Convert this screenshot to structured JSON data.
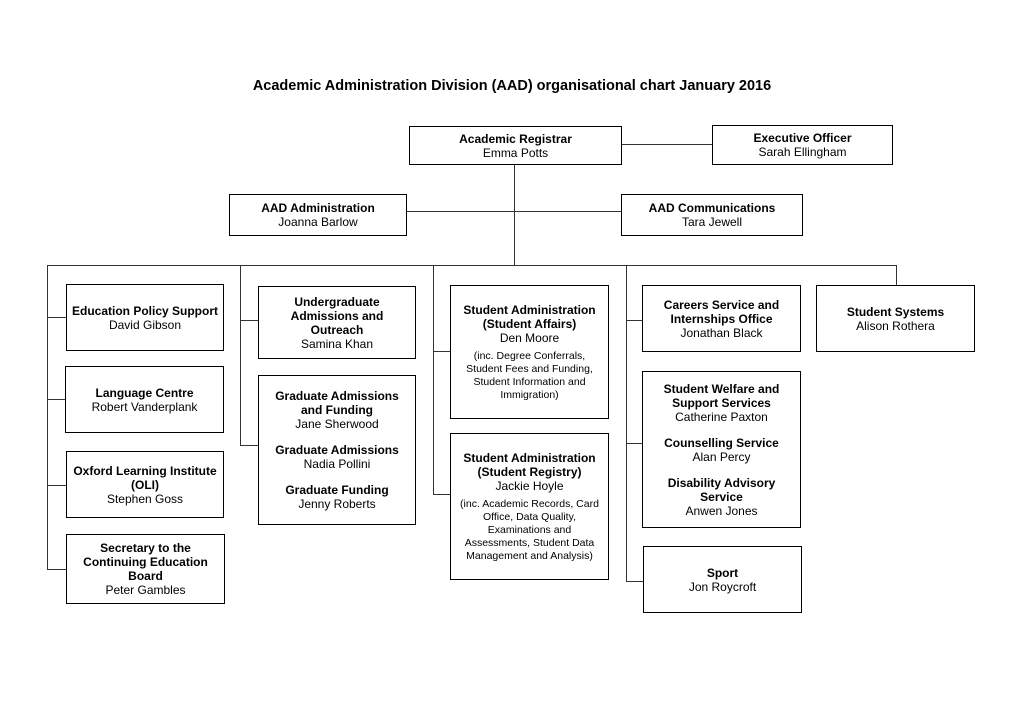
{
  "title": "Academic Administration Division (AAD) organisational chart January 2016",
  "top": {
    "registrar": {
      "title": "Academic Registrar",
      "name": "Emma Potts"
    },
    "executive_officer": {
      "title": "Executive Officer",
      "name": "Sarah Ellingham"
    },
    "administration": {
      "title": "AAD Administration",
      "name": "Joanna Barlow"
    },
    "communications": {
      "title": "AAD Communications",
      "name": "Tara Jewell"
    }
  },
  "columns": [
    {
      "units": [
        {
          "title": "Education Policy Support",
          "name": "David Gibson"
        },
        {
          "title": "Language Centre",
          "name": "Robert Vanderplank"
        },
        {
          "title": "Oxford Learning Institute (OLI)",
          "name": "Stephen Goss"
        },
        {
          "title": "Secretary to the Continuing Education Board",
          "name": "Peter Gambles"
        }
      ]
    },
    {
      "units": [
        {
          "title": "Undergraduate Admissions and Outreach",
          "name": "Samina Khan"
        },
        {
          "sections": [
            {
              "title": "Graduate Admissions and Funding",
              "name": "Jane Sherwood"
            },
            {
              "title": "Graduate Admissions",
              "name": "Nadia Pollini"
            },
            {
              "title": "Graduate Funding",
              "name": "Jenny Roberts"
            }
          ]
        }
      ]
    },
    {
      "units": [
        {
          "title": "Student Administration (Student Affairs)",
          "name": "Den Moore",
          "note": "(inc. Degree Conferrals, Student Fees and Funding, Student Information and Immigration)"
        },
        {
          "title": "Student Administration (Student Registry)",
          "name": "Jackie Hoyle",
          "note": "(inc. Academic Records, Card Office, Data Quality, Examinations and Assessments, Student Data Management and Analysis)"
        }
      ]
    },
    {
      "units": [
        {
          "title": "Careers Service and Internships Office",
          "name": "Jonathan Black"
        },
        {
          "sections": [
            {
              "title": "Student Welfare and Support Services",
              "name": "Catherine Paxton"
            },
            {
              "title": "Counselling Service",
              "name": "Alan Percy"
            },
            {
              "title": "Disability Advisory Service",
              "name": "Anwen Jones"
            }
          ]
        },
        {
          "title": "Sport",
          "name": "Jon Roycroft"
        }
      ]
    },
    {
      "units": [
        {
          "title": "Student Systems",
          "name": "Alison Rothera"
        }
      ]
    }
  ]
}
